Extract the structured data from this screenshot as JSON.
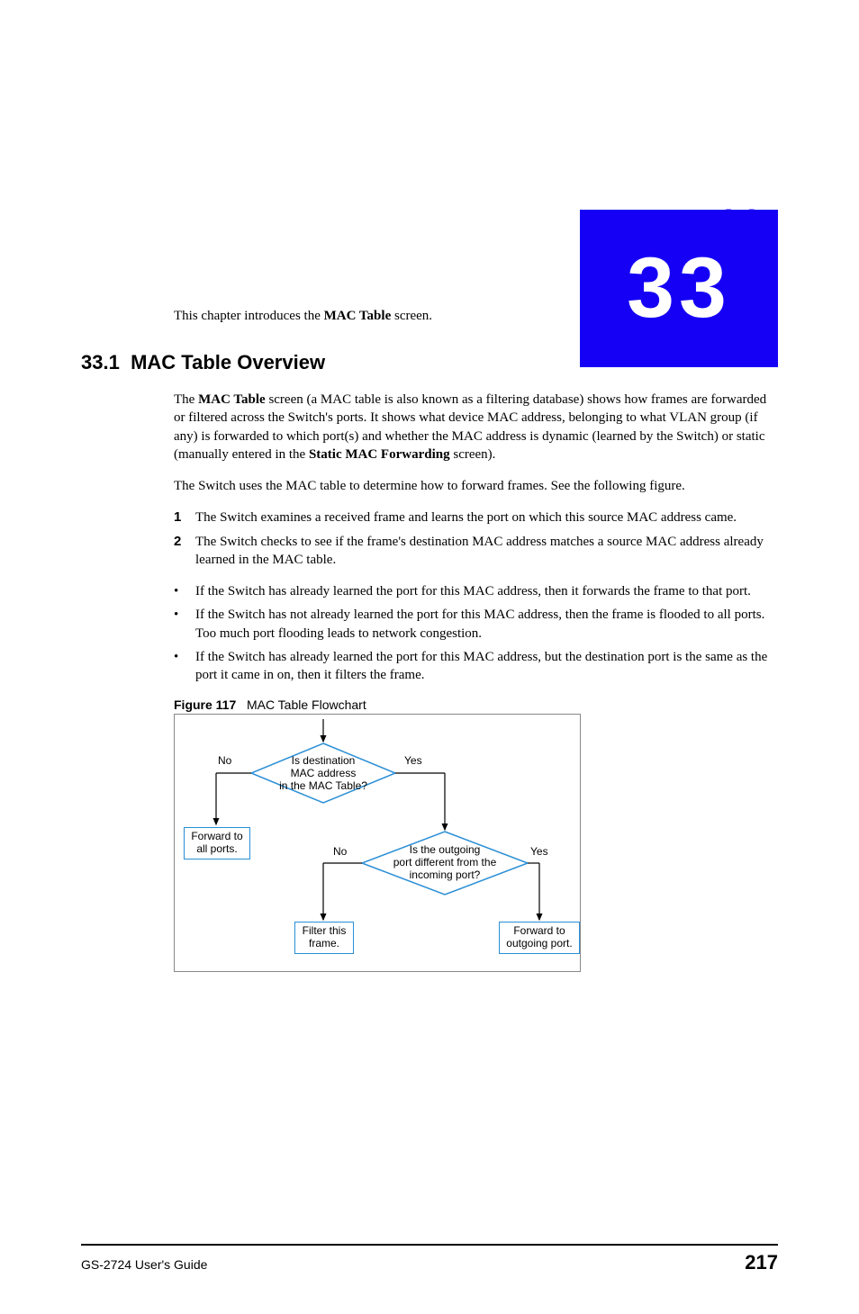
{
  "chapter": {
    "number": "33",
    "title": "MAC Table"
  },
  "intro": {
    "prefix": "This chapter introduces the ",
    "bold": "MAC Table",
    "suffix": " screen."
  },
  "section": {
    "number": "33.1",
    "title": "MAC Table Overview"
  },
  "para1": {
    "t1": "The ",
    "b1": "MAC Table",
    "t2": " screen (a MAC table is also known as a filtering database) shows how frames are forwarded or filtered across the Switch's ports. It shows what device MAC address, belonging to what VLAN group (if any) is forwarded to which port(s) and whether the MAC address is dynamic (learned by the Switch) or static (manually entered in the ",
    "b2": "Static MAC Forwarding",
    "t3": " screen)."
  },
  "para2": "The Switch uses the MAC table to determine how to forward frames. See the following figure.",
  "numbered": [
    "The Switch examines a received frame and learns the port on which this source MAC address came.",
    "The Switch checks to see if the frame's destination MAC address matches a source MAC address already learned in the MAC table."
  ],
  "bullets": [
    "If the Switch has already learned the port for this MAC address, then it forwards the frame to that port.",
    "If the Switch has not already learned the port for this MAC address, then the frame is flooded to all ports. Too much port flooding leads to network congestion.",
    "If the Switch has already learned the port for this MAC address, but the destination port is the same as the port it came in on, then it filters the frame."
  ],
  "figure": {
    "label": "Figure 117",
    "caption": "MAC Table Flowchart",
    "decision1": "Is destination\nMAC address\nin the MAC Table?",
    "no1": "No",
    "yes1": "Yes",
    "box_left": "Forward to\nall ports.",
    "decision2": "Is the outgoing\nport different from the\nincoming port?",
    "no2": "No",
    "yes2": "Yes",
    "box_filter": "Filter this\nframe.",
    "box_forward": "Forward to\noutgoing port."
  },
  "footer": {
    "guide": "GS-2724 User's Guide",
    "page": "217"
  }
}
